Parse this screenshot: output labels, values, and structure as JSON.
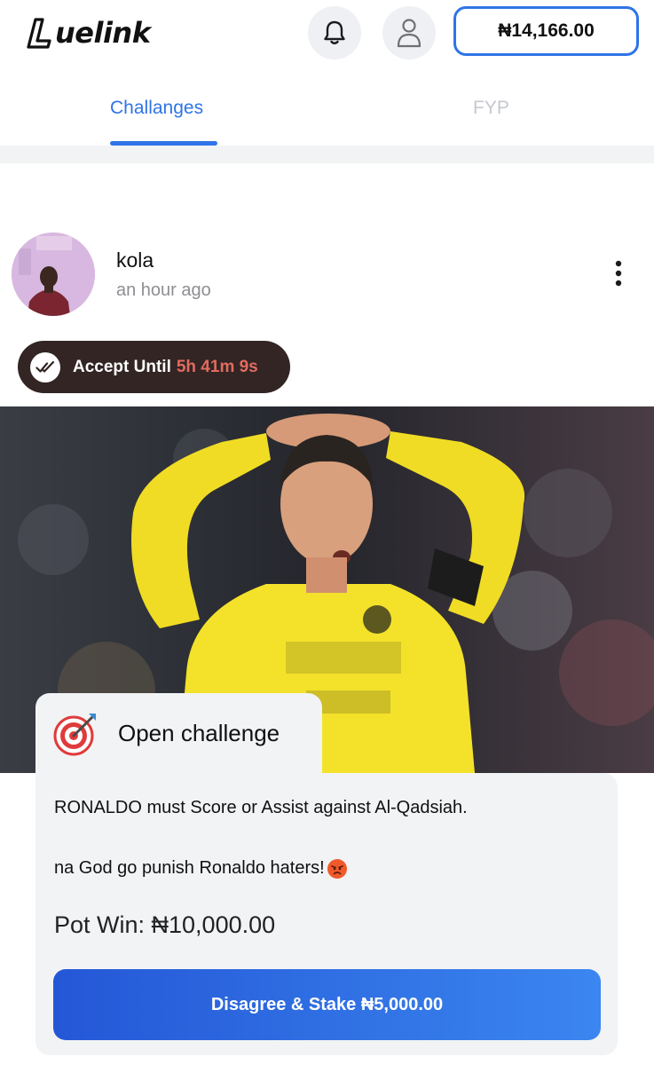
{
  "header": {
    "logo_text": "uelink",
    "balance": "₦14,166.00"
  },
  "tabs": [
    {
      "label": "Challanges",
      "active": true
    },
    {
      "label": "FYP",
      "active": false
    }
  ],
  "post": {
    "username": "kola",
    "time": "an hour ago",
    "accept_label": "Accept Until",
    "accept_time": "5h 41m 9s"
  },
  "challenge": {
    "title": "Open challenge",
    "description_line1": "RONALDO must Score or Assist against Al-Qadsiah.",
    "description_line2": "na God go punish Ronaldo haters!",
    "pot_win": "Pot Win: ₦10,000.00",
    "cta_label": "Disagree & Stake ₦5,000.00"
  },
  "colors": {
    "accent": "#2f74e6",
    "timer": "#e26b5f",
    "pill": "#322524",
    "card": "#f2f3f5",
    "jersey": "#f4e22a"
  },
  "icons": [
    "bell-icon",
    "user-icon",
    "more-vertical-icon",
    "double-check-icon",
    "target-icon",
    "angry-face-emoji"
  ]
}
